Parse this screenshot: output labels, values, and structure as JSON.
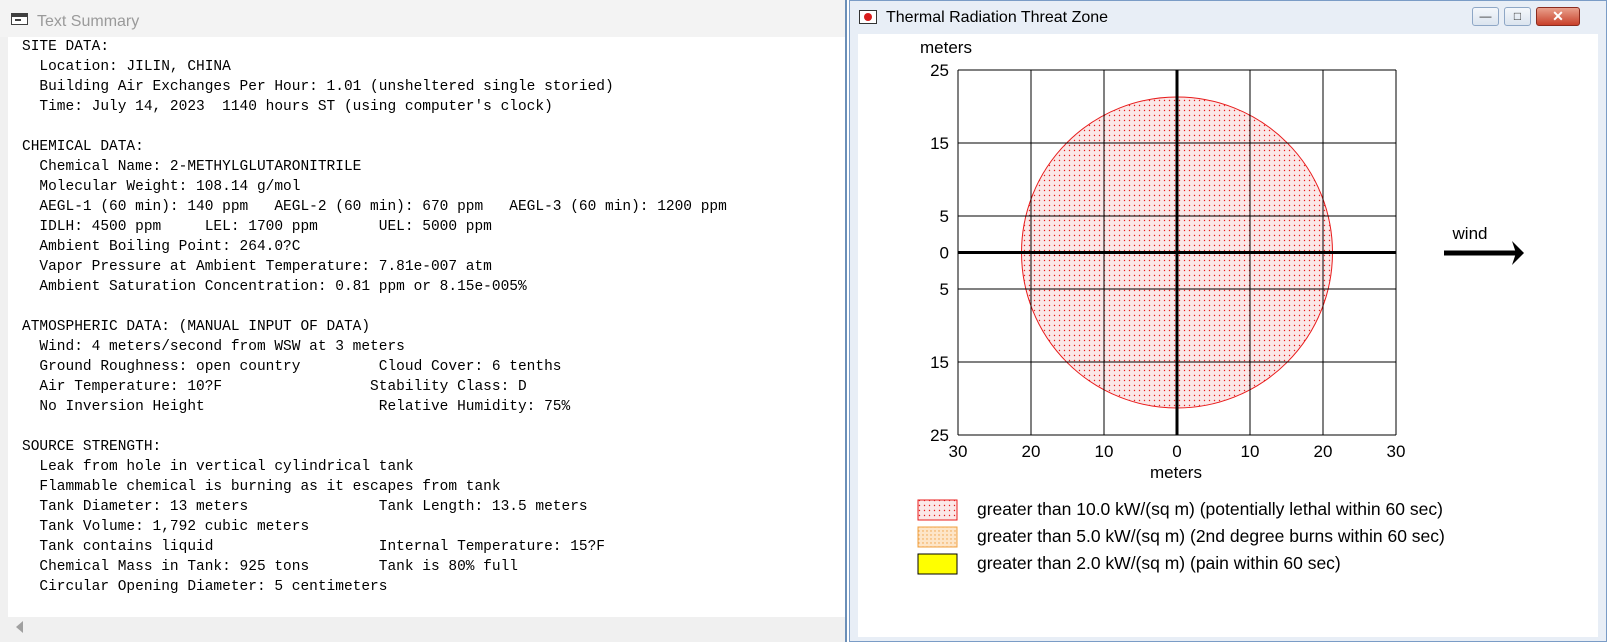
{
  "text_window": {
    "title": "Text Summary",
    "lines": [
      "SITE DATA:",
      "  Location: JILIN, CHINA",
      "  Building Air Exchanges Per Hour: 1.01 (unsheltered single storied)",
      "  Time: July 14, 2023  1140 hours ST (using computer's clock)",
      "",
      "CHEMICAL DATA:",
      "  Chemical Name: 2-METHYLGLUTARONITRILE",
      "  Molecular Weight: 108.14 g/mol",
      "  AEGL-1 (60 min): 140 ppm   AEGL-2 (60 min): 670 ppm   AEGL-3 (60 min): 1200 ppm",
      "  IDLH: 4500 ppm     LEL: 1700 ppm       UEL: 5000 ppm",
      "  Ambient Boiling Point: 264.0?C",
      "  Vapor Pressure at Ambient Temperature: 7.81e-007 atm",
      "  Ambient Saturation Concentration: 0.81 ppm or 8.15e-005%",
      "",
      "ATMOSPHERIC DATA: (MANUAL INPUT OF DATA)",
      "  Wind: 4 meters/second from WSW at 3 meters",
      "  Ground Roughness: open country         Cloud Cover: 6 tenths",
      "  Air Temperature: 10?F                 Stability Class: D",
      "  No Inversion Height                    Relative Humidity: 75%",
      "",
      "SOURCE STRENGTH:",
      "  Leak from hole in vertical cylindrical tank",
      "  Flammable chemical is burning as it escapes from tank",
      "  Tank Diameter: 13 meters               Tank Length: 13.5 meters",
      "  Tank Volume: 1,792 cubic meters",
      "  Tank contains liquid                   Internal Temperature: 15?F",
      "  Chemical Mass in Tank: 925 tons        Tank is 80% full",
      "  Circular Opening Diameter: 5 centimeters"
    ]
  },
  "plot_window": {
    "title": "Thermal Radiation Threat Zone",
    "buttons": {
      "minimize": "—",
      "maximize": "□",
      "close": "✕"
    },
    "wind_label": "wind",
    "wind_direction": "east",
    "colors": {
      "zone_red": "#e81c1c",
      "zone_red_fill": "#fbe0e0",
      "zone_orange": "#f0a040",
      "zone_orange_fill": "#fde5c8",
      "zone_yellow": "#ffff00",
      "grid": "#000000"
    }
  },
  "chart_data": {
    "type": "scatter",
    "y_axis_label": "meters",
    "x_axis_label": "meters",
    "xlim": [
      -30,
      30
    ],
    "ylim": [
      -25,
      25
    ],
    "x_ticks": [
      -30,
      -20,
      -10,
      0,
      10,
      20,
      30
    ],
    "x_tick_labels": [
      "30",
      "20",
      "10",
      "0",
      "10",
      "20",
      "30"
    ],
    "y_ticks": [
      25,
      15,
      5,
      0,
      -5,
      -15,
      -25
    ],
    "y_tick_labels": [
      "25",
      "15",
      "5",
      "0",
      "5",
      "15",
      "25"
    ],
    "grid": true,
    "zones": [
      {
        "name": "red zone",
        "center": [
          0,
          0
        ],
        "radius": 21.3,
        "color": "#e81c1c"
      }
    ],
    "legend": [
      {
        "label": "greater than 10.0 kW/(sq m) (potentially lethal within 60 sec)",
        "style": "red-dotted"
      },
      {
        "label": "greater than 5.0 kW/(sq m) (2nd degree burns within 60 sec)",
        "style": "orange-dotted"
      },
      {
        "label": "greater than 2.0 kW/(sq m) (pain within 60 sec)",
        "style": "yellow-solid"
      }
    ]
  }
}
